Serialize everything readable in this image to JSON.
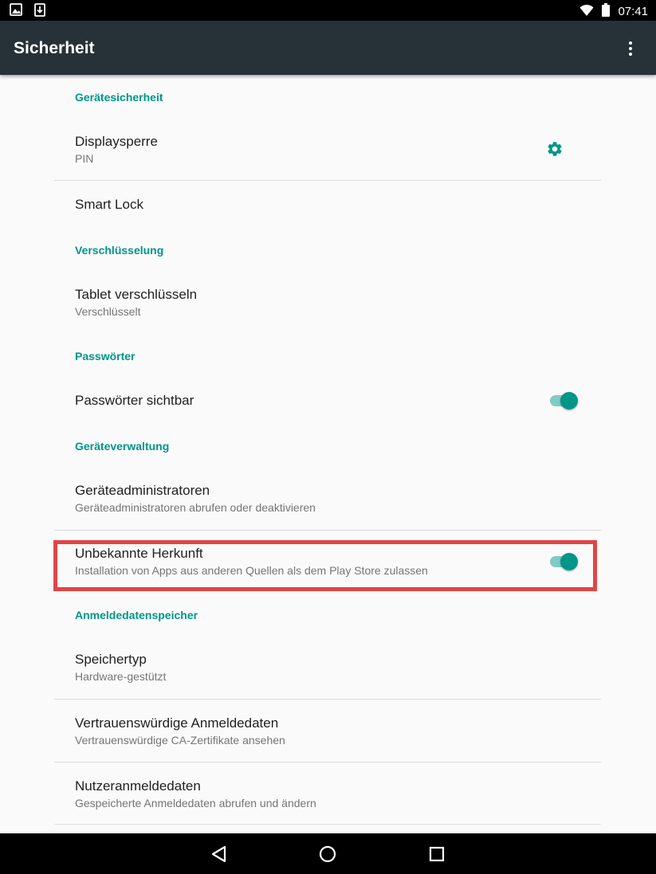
{
  "status_bar": {
    "time": "07:41",
    "left_icons": [
      "image-icon",
      "download-icon"
    ],
    "right_icons": [
      "wifi-icon",
      "battery-icon"
    ]
  },
  "app_bar": {
    "title": "Sicherheit",
    "menu_icon": "overflow-menu-icon"
  },
  "sections": {
    "device_security": {
      "header": "Gerätesicherheit",
      "screen_lock": {
        "title": "Displaysperre",
        "summary": "PIN",
        "icon": "gear-icon"
      },
      "smart_lock": {
        "title": "Smart Lock"
      }
    },
    "encryption": {
      "header": "Verschlüsselung",
      "encrypt_tablet": {
        "title": "Tablet verschlüsseln",
        "summary": "Verschlüsselt"
      }
    },
    "passwords": {
      "header": "Passwörter",
      "show_passwords": {
        "title": "Passwörter sichtbar",
        "enabled": true
      }
    },
    "device_admin": {
      "header": "Geräteverwaltung",
      "admins": {
        "title": "Geräteadministratoren",
        "summary": "Geräteadministratoren abrufen oder deaktivieren"
      },
      "unknown_sources": {
        "title": "Unbekannte Herkunft",
        "summary": "Installation von Apps aus anderen Quellen als dem Play Store zulassen",
        "enabled": true,
        "highlighted": true
      }
    },
    "credential_storage": {
      "header": "Anmeldedatenspeicher",
      "storage_type": {
        "title": "Speichertyp",
        "summary": "Hardware-gestützt"
      },
      "trusted_credentials": {
        "title": "Vertrauenswürdige Anmeldedaten",
        "summary": "Vertrauenswürdige CA-Zertifikate ansehen"
      },
      "user_credentials": {
        "title": "Nutzeranmeldedaten",
        "summary": "Gespeicherte Anmeldedaten abrufen und ändern"
      }
    }
  },
  "nav_bar": {
    "buttons": [
      "back-icon",
      "home-icon",
      "recents-icon"
    ]
  },
  "colors": {
    "accent": "#009688",
    "accent_light": "#80cbc4",
    "app_bar": "#263238",
    "highlight_border": "#e34545",
    "background": "#fafafa"
  }
}
